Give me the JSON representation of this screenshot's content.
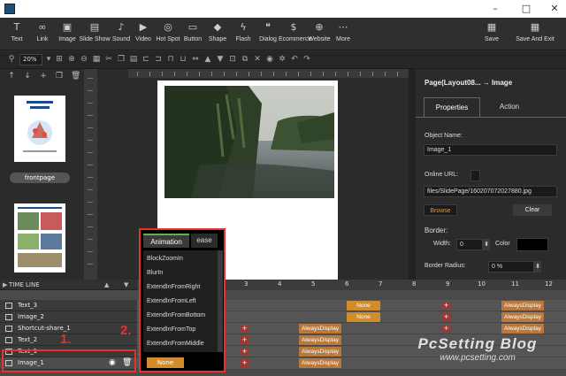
{
  "window": {
    "minimize": "–",
    "maximize": "□",
    "close": "✕"
  },
  "toolbar": {
    "tools": [
      "Text",
      "Link",
      "Image",
      "Slide Show",
      "Sound",
      "Video",
      "Hot Spot",
      "Button",
      "Shape",
      "Flash",
      "Dialog",
      "Ecommerce",
      "Website",
      "More"
    ],
    "save": "Save",
    "save_exit": "Save And Exit"
  },
  "subbar": {
    "zoom": "20%"
  },
  "thumbnails": {
    "frontpage_label": "frontpage"
  },
  "properties": {
    "header": "Page(Layout08... → Image",
    "tab_properties": "Properties",
    "tab_action": "Action",
    "object_name_label": "Object Name:",
    "object_name_value": "Image_1",
    "online_url_label": "Online URL:",
    "path_value": "files/SlidePage/160207072027880.jpg",
    "browse": "Browse",
    "clear": "Clear",
    "border_label": "Border:",
    "width_label": "Width:",
    "width_value": "0",
    "color_label": "Color",
    "border_radius_label": "Border Radius:",
    "border_radius_value": "0 %"
  },
  "timeline": {
    "title": "TIME LINE",
    "scale": [
      "2",
      "3",
      "4",
      "5",
      "6",
      "7",
      "8",
      "9",
      "10",
      "11",
      "12"
    ],
    "layers": [
      "Text_3",
      "Image_2",
      "Shortcut-share_1",
      "Text_2",
      "Text_1",
      "Image_1"
    ],
    "pill_none": "None",
    "pill_always": "AlwaysDisplay"
  },
  "animation": {
    "tab_animation": "Animation",
    "tab_ease": "ease",
    "items": [
      "BlockZoomIn",
      "BlurIn",
      "ExtendInFromRight",
      "ExtendInFromLeft",
      "ExtendInFromBottom",
      "ExtendInFromTop",
      "ExtendInFromMiddle"
    ],
    "none_button": "None"
  },
  "annotations": {
    "one": "1.",
    "two": "2."
  },
  "watermark": {
    "line1": "PcSetting Blog",
    "line2": "www.pcsetting.com"
  },
  "colors": {
    "accent_orange": "#d18c2c",
    "annotation_red": "#e8312f",
    "animation_tab_green": "#5fb14d"
  }
}
